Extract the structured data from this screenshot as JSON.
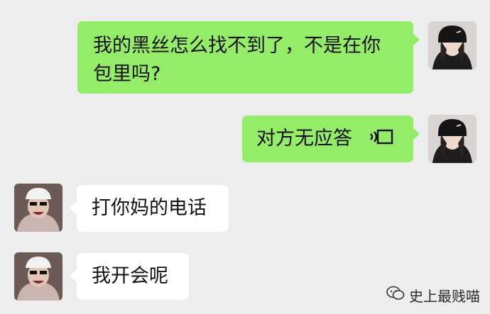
{
  "messages": [
    {
      "id": "m1",
      "side": "out",
      "text": "我的黑丝怎么找不到了，不是在你包里吗?"
    },
    {
      "id": "m2",
      "side": "out",
      "text": "对方无应答",
      "icon": "voice-call-icon"
    },
    {
      "id": "m3",
      "side": "in",
      "text": "打你妈的电话"
    },
    {
      "id": "m4",
      "side": "in",
      "text": "我开会呢"
    }
  ],
  "watermark": {
    "text": "史上最贱喵",
    "icon": "wechat-official-account-icon"
  },
  "colors": {
    "background": "#ededed",
    "outgoing_bubble": "#95ec69",
    "incoming_bubble": "#ffffff"
  }
}
